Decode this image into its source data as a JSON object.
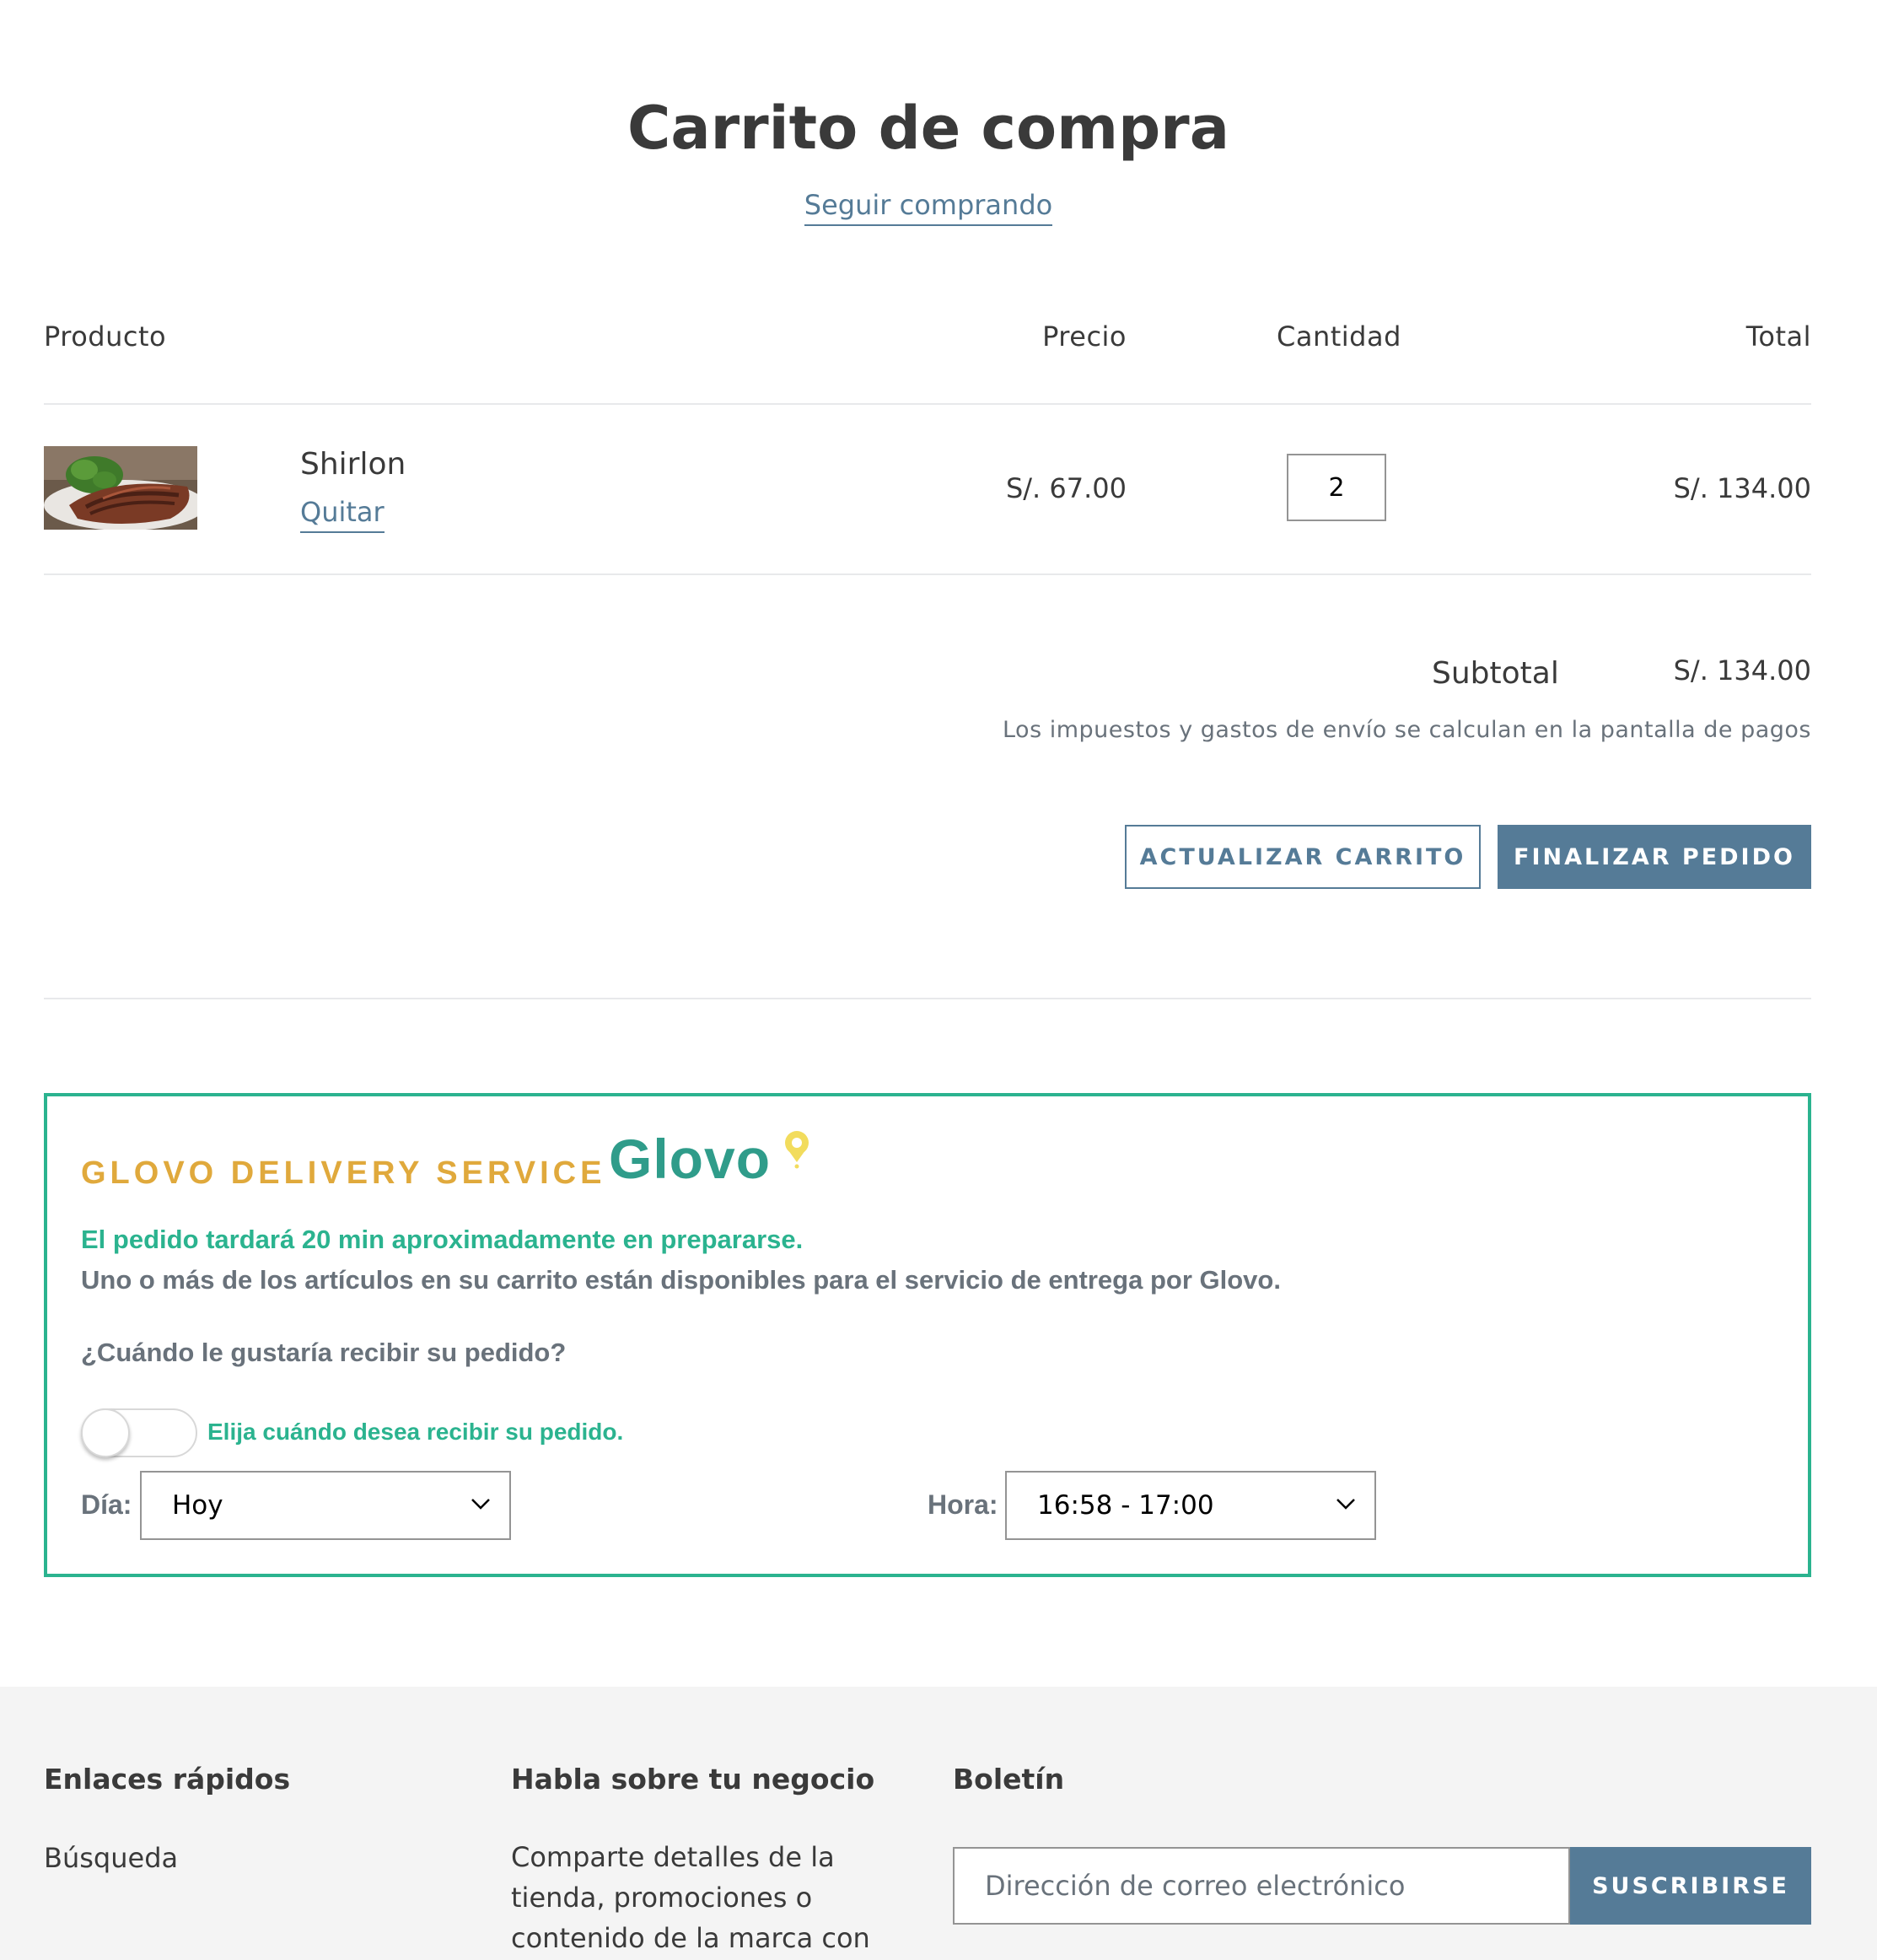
{
  "page": {
    "title": "Carrito de compra",
    "continue_shopping": "Seguir comprando"
  },
  "cart": {
    "headers": {
      "product": "Producto",
      "price": "Precio",
      "quantity": "Cantidad",
      "total": "Total"
    },
    "items": [
      {
        "name": "Shirlon",
        "remove_label": "Quitar",
        "price": "S/. 67.00",
        "quantity": "2",
        "total": "S/. 134.00"
      }
    ],
    "subtotal_label": "Subtotal",
    "subtotal_value": "S/. 134.00",
    "tax_note": "Los impuestos y gastos de envío se calculan en la pantalla de pagos",
    "update_button": "ACTUALIZAR CARRITO",
    "checkout_button": "FINALIZAR PEDIDO"
  },
  "glovo": {
    "title": "GLOVO DELIVERY SERVICE",
    "logo_text": "Glovo",
    "prep_note": "El pedido tardará 20 min aproximadamente en prepararse.",
    "availability_note": "Uno o más de los artículos en su carrito están disponibles para el servicio de entrega por Glovo.",
    "when_question": "¿Cuándo le gustaría recibir su pedido?",
    "toggle_on": false,
    "toggle_label": "Elija cuándo desea recibir su pedido.",
    "day_label": "Día:",
    "day_value": "Hoy",
    "time_label": "Hora:",
    "time_value": "16:58 - 17:00",
    "colors": {
      "border": "#2bb38f",
      "title": "#e0a93c",
      "logo": "#2f9c8a",
      "pin": "#f2dc5d"
    }
  },
  "footer": {
    "quick_links_heading": "Enlaces rápidos",
    "quick_links": [
      "Búsqueda"
    ],
    "business_heading": "Habla sobre tu negocio",
    "business_text": "Comparte detalles de la tienda, promociones o contenido de la marca con",
    "newsletter_heading": "Boletín",
    "email_placeholder": "Dirección de correo electrónico",
    "subscribe_button": "SUSCRIBIRSE"
  },
  "theme": {
    "accent": "#557b97",
    "text": "#3a3a3a"
  }
}
